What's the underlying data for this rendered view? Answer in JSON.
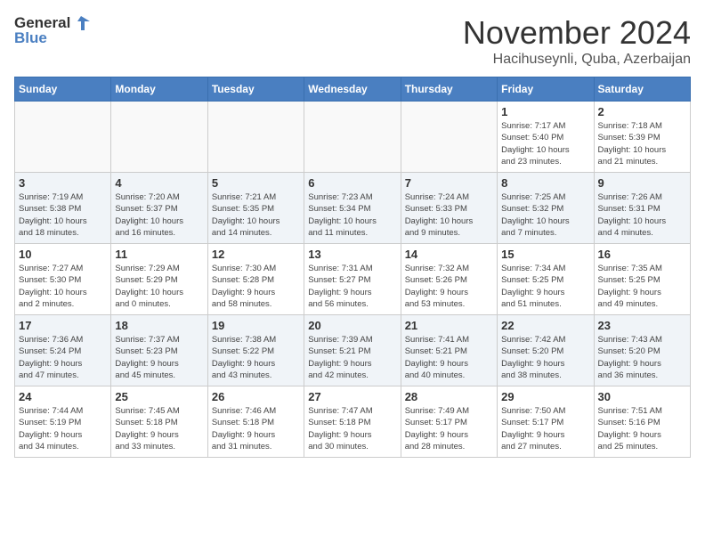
{
  "header": {
    "logo_line1": "General",
    "logo_line2": "Blue",
    "month": "November 2024",
    "location": "Hacihuseynli, Quba, Azerbaijan"
  },
  "weekdays": [
    "Sunday",
    "Monday",
    "Tuesday",
    "Wednesday",
    "Thursday",
    "Friday",
    "Saturday"
  ],
  "weeks": [
    [
      {
        "day": "",
        "info": ""
      },
      {
        "day": "",
        "info": ""
      },
      {
        "day": "",
        "info": ""
      },
      {
        "day": "",
        "info": ""
      },
      {
        "day": "",
        "info": ""
      },
      {
        "day": "1",
        "info": "Sunrise: 7:17 AM\nSunset: 5:40 PM\nDaylight: 10 hours\nand 23 minutes."
      },
      {
        "day": "2",
        "info": "Sunrise: 7:18 AM\nSunset: 5:39 PM\nDaylight: 10 hours\nand 21 minutes."
      }
    ],
    [
      {
        "day": "3",
        "info": "Sunrise: 7:19 AM\nSunset: 5:38 PM\nDaylight: 10 hours\nand 18 minutes."
      },
      {
        "day": "4",
        "info": "Sunrise: 7:20 AM\nSunset: 5:37 PM\nDaylight: 10 hours\nand 16 minutes."
      },
      {
        "day": "5",
        "info": "Sunrise: 7:21 AM\nSunset: 5:35 PM\nDaylight: 10 hours\nand 14 minutes."
      },
      {
        "day": "6",
        "info": "Sunrise: 7:23 AM\nSunset: 5:34 PM\nDaylight: 10 hours\nand 11 minutes."
      },
      {
        "day": "7",
        "info": "Sunrise: 7:24 AM\nSunset: 5:33 PM\nDaylight: 10 hours\nand 9 minutes."
      },
      {
        "day": "8",
        "info": "Sunrise: 7:25 AM\nSunset: 5:32 PM\nDaylight: 10 hours\nand 7 minutes."
      },
      {
        "day": "9",
        "info": "Sunrise: 7:26 AM\nSunset: 5:31 PM\nDaylight: 10 hours\nand 4 minutes."
      }
    ],
    [
      {
        "day": "10",
        "info": "Sunrise: 7:27 AM\nSunset: 5:30 PM\nDaylight: 10 hours\nand 2 minutes."
      },
      {
        "day": "11",
        "info": "Sunrise: 7:29 AM\nSunset: 5:29 PM\nDaylight: 10 hours\nand 0 minutes."
      },
      {
        "day": "12",
        "info": "Sunrise: 7:30 AM\nSunset: 5:28 PM\nDaylight: 9 hours\nand 58 minutes."
      },
      {
        "day": "13",
        "info": "Sunrise: 7:31 AM\nSunset: 5:27 PM\nDaylight: 9 hours\nand 56 minutes."
      },
      {
        "day": "14",
        "info": "Sunrise: 7:32 AM\nSunset: 5:26 PM\nDaylight: 9 hours\nand 53 minutes."
      },
      {
        "day": "15",
        "info": "Sunrise: 7:34 AM\nSunset: 5:25 PM\nDaylight: 9 hours\nand 51 minutes."
      },
      {
        "day": "16",
        "info": "Sunrise: 7:35 AM\nSunset: 5:25 PM\nDaylight: 9 hours\nand 49 minutes."
      }
    ],
    [
      {
        "day": "17",
        "info": "Sunrise: 7:36 AM\nSunset: 5:24 PM\nDaylight: 9 hours\nand 47 minutes."
      },
      {
        "day": "18",
        "info": "Sunrise: 7:37 AM\nSunset: 5:23 PM\nDaylight: 9 hours\nand 45 minutes."
      },
      {
        "day": "19",
        "info": "Sunrise: 7:38 AM\nSunset: 5:22 PM\nDaylight: 9 hours\nand 43 minutes."
      },
      {
        "day": "20",
        "info": "Sunrise: 7:39 AM\nSunset: 5:21 PM\nDaylight: 9 hours\nand 42 minutes."
      },
      {
        "day": "21",
        "info": "Sunrise: 7:41 AM\nSunset: 5:21 PM\nDaylight: 9 hours\nand 40 minutes."
      },
      {
        "day": "22",
        "info": "Sunrise: 7:42 AM\nSunset: 5:20 PM\nDaylight: 9 hours\nand 38 minutes."
      },
      {
        "day": "23",
        "info": "Sunrise: 7:43 AM\nSunset: 5:20 PM\nDaylight: 9 hours\nand 36 minutes."
      }
    ],
    [
      {
        "day": "24",
        "info": "Sunrise: 7:44 AM\nSunset: 5:19 PM\nDaylight: 9 hours\nand 34 minutes."
      },
      {
        "day": "25",
        "info": "Sunrise: 7:45 AM\nSunset: 5:18 PM\nDaylight: 9 hours\nand 33 minutes."
      },
      {
        "day": "26",
        "info": "Sunrise: 7:46 AM\nSunset: 5:18 PM\nDaylight: 9 hours\nand 31 minutes."
      },
      {
        "day": "27",
        "info": "Sunrise: 7:47 AM\nSunset: 5:18 PM\nDaylight: 9 hours\nand 30 minutes."
      },
      {
        "day": "28",
        "info": "Sunrise: 7:49 AM\nSunset: 5:17 PM\nDaylight: 9 hours\nand 28 minutes."
      },
      {
        "day": "29",
        "info": "Sunrise: 7:50 AM\nSunset: 5:17 PM\nDaylight: 9 hours\nand 27 minutes."
      },
      {
        "day": "30",
        "info": "Sunrise: 7:51 AM\nSunset: 5:16 PM\nDaylight: 9 hours\nand 25 minutes."
      }
    ]
  ]
}
